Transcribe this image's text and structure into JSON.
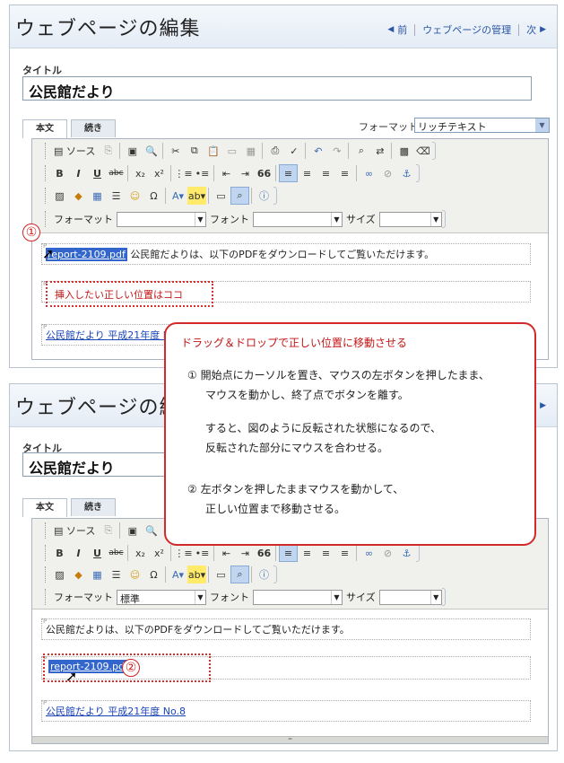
{
  "page_title": "ウェブページの編集",
  "nav": {
    "prev": "前",
    "manage": "ウェブページの管理",
    "next": "次"
  },
  "title_label": "タイトル",
  "title_value": "公民館だより",
  "tabs": [
    "本文",
    "続き"
  ],
  "format_label": "フォーマット:",
  "format_value": "リッチテキスト",
  "toolbar": {
    "source": "ソース",
    "bold": "B",
    "italic": "I",
    "underline": "U",
    "strike": "abc",
    "sub": "x₂",
    "sup": "x²",
    "quote": "66",
    "omega": "Ω",
    "help": "?",
    "fmt_label": "フォーマット",
    "font_label": "フォント",
    "size_label": "サイズ",
    "fmt_value_bottom": "標準"
  },
  "top_editor": {
    "file_link": "report-2109.pdf",
    "sentence": "公民館だよりは、以下のPDFをダウンロードしてご覧いただけます。",
    "target_note": "挿入したい正しい位置はココ",
    "newsletter_link": "公民館だより 平成21年度 No.8"
  },
  "bottom_editor": {
    "sentence": "公民館だよりは、以下のPDFをダウンロードしてご覧いただけます。",
    "file_link": "report-2109.pdf",
    "newsletter_link": "公民館だより 平成21年度 No.8"
  },
  "step_numbers": {
    "one": "①",
    "two": "②"
  },
  "callout": {
    "title": "ドラッグ＆ドロップで正しい位置に移動させる",
    "s1a": "① 開始点にカーソルを置き、マウスの左ボタンを押したまま、",
    "s1b": "マウスを動かし、終了点でボタンを離す。",
    "s1c": "すると、図のように反転された状態になるので、",
    "s1d": "反転された部分にマウスを合わせる。",
    "s2a": "② 左ボタンを押したままマウスを動かして、",
    "s2b": "正しい位置まで移動させる。"
  },
  "colors": {
    "accent_red": "#d22a2a",
    "link_blue": "#1a44b8",
    "selection": "#3366cc"
  }
}
